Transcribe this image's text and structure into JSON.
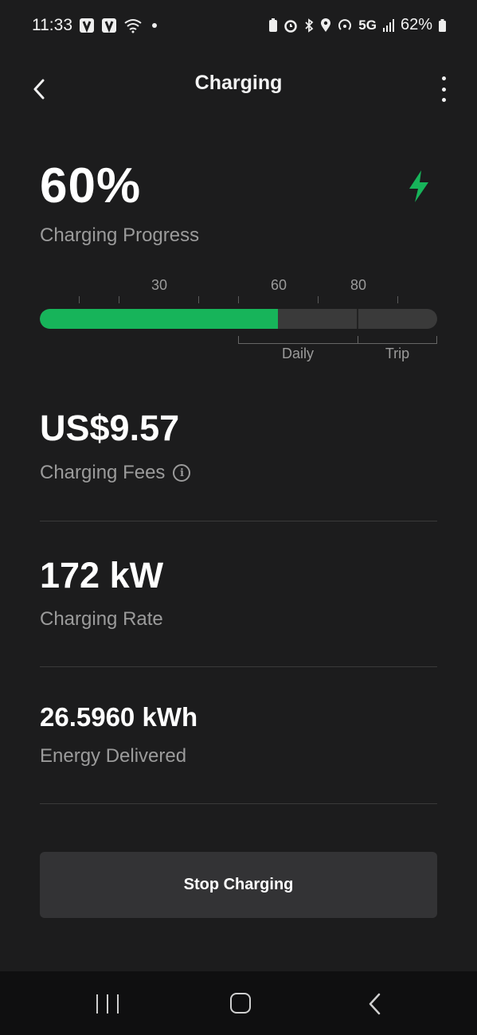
{
  "status_bar": {
    "time": "11:33",
    "network": "5G",
    "battery": "62%"
  },
  "header": {
    "title": "Charging"
  },
  "progress": {
    "percent_text": "60%",
    "label": "Charging Progress",
    "value": 60,
    "limit": 80,
    "scale_labels": [
      "30",
      "60",
      "80"
    ],
    "segments": [
      "Daily",
      "Trip"
    ],
    "fill_color": "#17b45a"
  },
  "stats": {
    "fees_value": "US$9.57",
    "fees_label": "Charging Fees",
    "rate_value": "172 kW",
    "rate_label": "Charging Rate",
    "energy_value": "26.5960 kWh",
    "energy_label": "Energy Delivered"
  },
  "actions": {
    "stop_label": "Stop Charging"
  },
  "icons": {
    "bolt": "lightning-bolt-icon",
    "back": "chevron-left-icon",
    "more": "more-vertical-icon",
    "info": "info-icon"
  },
  "colors": {
    "accent": "#17b45a",
    "background": "#1c1c1d"
  }
}
